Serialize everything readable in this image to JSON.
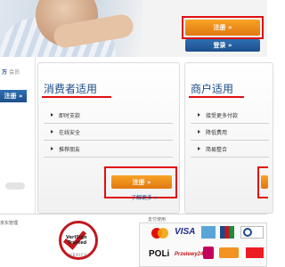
{
  "hero": {
    "signup_label": "注册 »",
    "login_label": "登录 »"
  },
  "left": {
    "member_count": "万",
    "member_unit": "会员",
    "button_label": "注册 »"
  },
  "consumer": {
    "title": "消费者适用",
    "benefits": [
      "即时支款",
      "在线安全",
      "推荐朋友"
    ],
    "signup_label": "注册 »",
    "learn_more": "了解更多 »"
  },
  "merchant": {
    "title": "商户适用",
    "benefits": [
      "接受更多付款",
      "降低费用",
      "简易整合"
    ]
  },
  "footer": {
    "left_text": "京东管理",
    "verisign_title": "VeriSign",
    "verisign_sub": "Trusted",
    "verisign_verify": "VERIFY ▸",
    "payment_label": "支付使用",
    "logos": [
      "mastercard-logo",
      "visa-logo",
      "amex-logo",
      "jcb-logo",
      "diners-club-logo",
      "poli-logo",
      "przelewy24-logo",
      "ideal-logo",
      "ulert-logo",
      "bank-logo"
    ],
    "visa_text": "VISA",
    "poli_text": "POLi",
    "przelewy_text": "Przelewy24"
  },
  "colors": {
    "accent_orange": "#f08a1c",
    "brand_blue": "#1b4a87",
    "highlight_red": "#e01010"
  }
}
